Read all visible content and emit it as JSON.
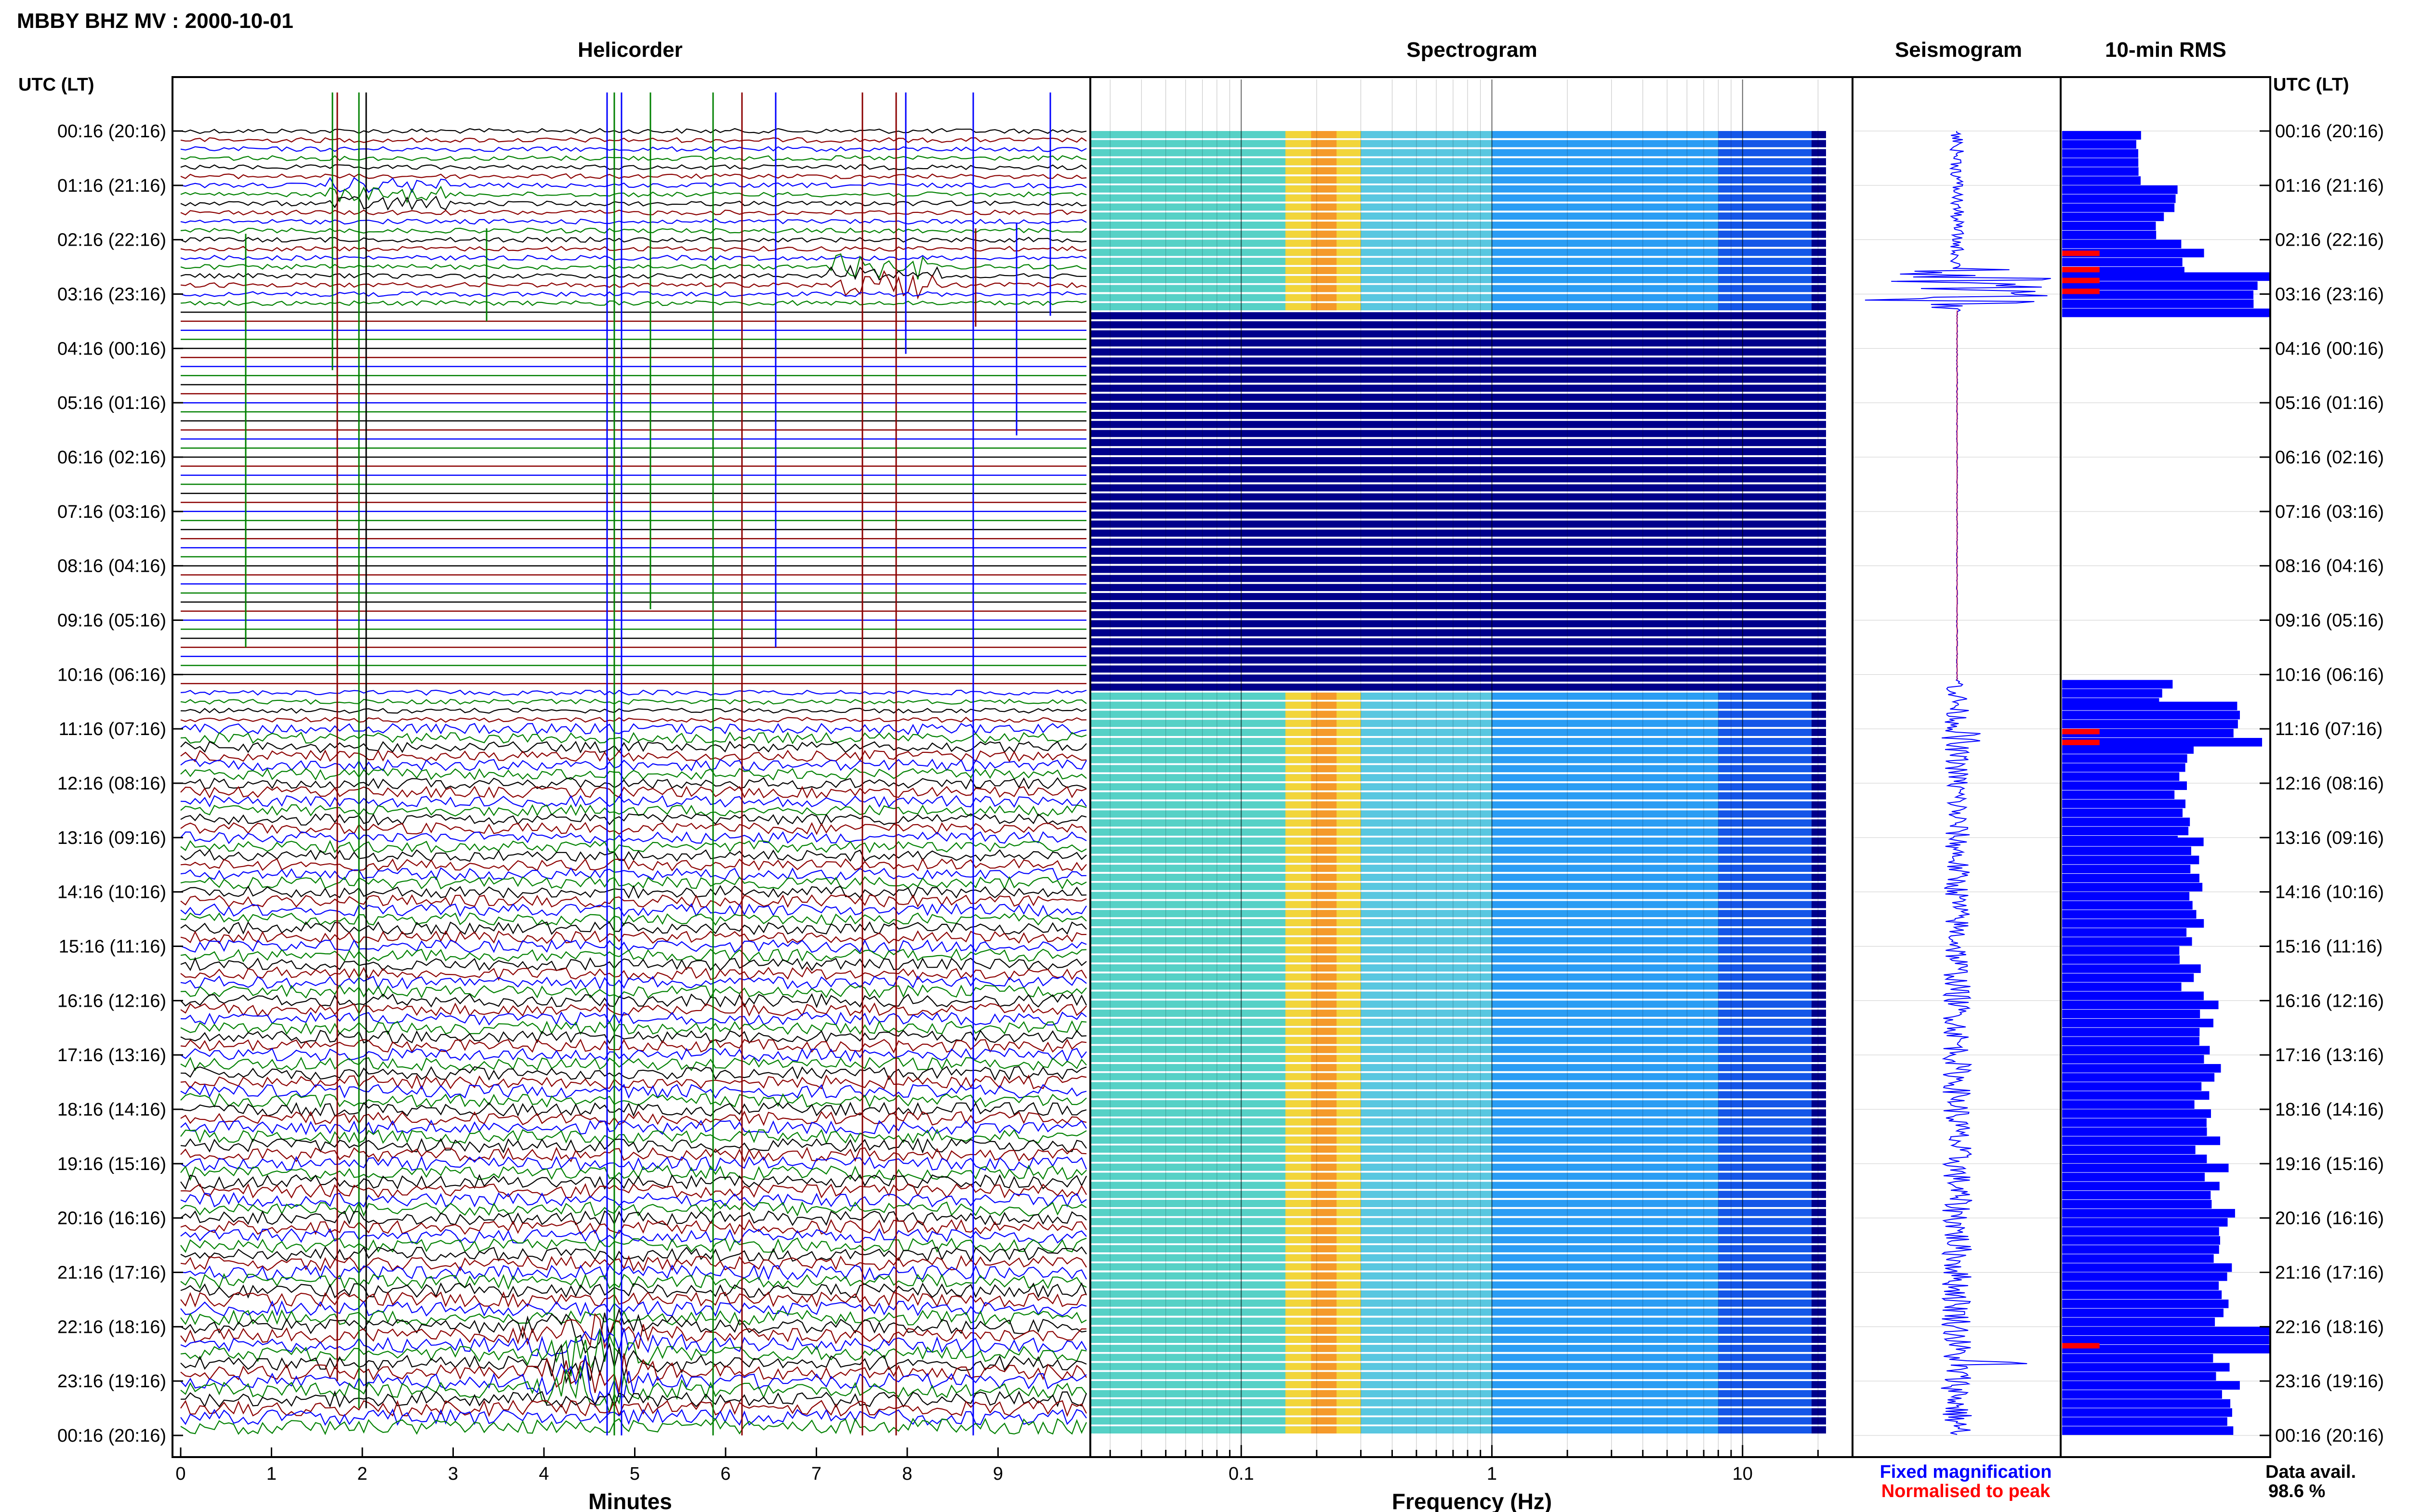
{
  "header": {
    "station_title": "MBBY BHZ MV : 2000-10-01",
    "time_axis_label": "UTC (LT)"
  },
  "panels": {
    "helicorder_title": "Helicorder",
    "spectrogram_title": "Spectrogram",
    "seismogram_title": "Seismogram",
    "rms_title": "10-min RMS"
  },
  "legend": {
    "fixed_magnification": "Fixed magnification",
    "normalised_to_peak": "Normalised to peak",
    "data_avail_label": "Data avail.",
    "data_avail_value": "98.6 %"
  },
  "colors": {
    "blue": "#0000ff",
    "red": "#ff0000",
    "dark_red": "#8b0000",
    "green": "#008000",
    "black": "#000000",
    "spectrogram_low": "#00008b"
  },
  "chart_data": [
    {
      "type": "line",
      "panel": "helicorder",
      "title": "Helicorder",
      "xlabel": "Minutes",
      "xlim": [
        0,
        10
      ],
      "x_ticks": [
        "0",
        "1",
        "2",
        "3",
        "4",
        "5",
        "6",
        "7",
        "8",
        "9"
      ],
      "y_tick_labels": [
        "00:16 (20:16)",
        "01:16 (21:16)",
        "02:16 (22:16)",
        "03:16 (23:16)",
        "04:16 (00:16)",
        "05:16 (01:16)",
        "06:16 (02:16)",
        "07:16 (03:16)",
        "08:16 (04:16)",
        "09:16 (05:16)",
        "10:16 (06:16)",
        "11:16 (07:16)",
        "12:16 (08:16)",
        "13:16 (09:16)",
        "14:16 (10:16)",
        "15:16 (11:16)",
        "16:16 (12:16)",
        "17:16 (13:16)",
        "18:16 (14:16)",
        "19:16 (15:16)",
        "20:16 (16:16)",
        "21:16 (17:16)",
        "22:16 (18:16)",
        "23:16 (19:16)",
        "00:16 (20:16)"
      ],
      "trace_colors_cycle": [
        "black",
        "dark_red",
        "blue",
        "green"
      ],
      "minutes_per_line": 10,
      "lines_total": 144,
      "flat_gap_hours": [
        3.2,
        10.3
      ]
    },
    {
      "type": "heatmap",
      "panel": "spectrogram",
      "title": "Spectrogram",
      "xlabel": "Frequency (Hz)",
      "x_scale": "log",
      "x_ticks": [
        0.1,
        1,
        10
      ],
      "x_tick_labels": [
        "0.1",
        "1",
        "10"
      ],
      "xlim": [
        0.025,
        40
      ],
      "peak_band_hz": [
        0.15,
        0.3
      ],
      "gap_hours": [
        3.2,
        10.3
      ]
    },
    {
      "type": "line",
      "panel": "seismogram",
      "title": "Seismogram",
      "series": [
        {
          "name": "Fixed magnification",
          "color": "blue"
        },
        {
          "name": "Normalised to peak",
          "color": "red"
        }
      ],
      "events_hours": [
        2.9,
        11.2,
        15.1,
        22.7
      ]
    },
    {
      "type": "bar",
      "panel": "rms",
      "title": "10-min RMS",
      "orientation": "horizontal",
      "ylabel": "UTC (LT)",
      "bin_minutes": 10,
      "range_hours": [
        0,
        24
      ],
      "gap_hours": [
        3.3,
        10.1
      ],
      "rms_relative_segments": [
        {
          "from_hour": 0.0,
          "to_hour": 1.0,
          "value": 0.36
        },
        {
          "from_hour": 1.0,
          "to_hour": 1.5,
          "value": 0.52
        },
        {
          "from_hour": 1.5,
          "to_hour": 2.0,
          "value": 0.46
        },
        {
          "from_hour": 2.0,
          "to_hour": 2.6,
          "value": 0.62
        },
        {
          "from_hour": 2.6,
          "to_hour": 3.3,
          "value": 1.0
        },
        {
          "from_hour": 10.1,
          "to_hour": 10.5,
          "value": 0.5
        },
        {
          "from_hour": 10.5,
          "to_hour": 11.3,
          "value": 0.9
        },
        {
          "from_hour": 11.3,
          "to_hour": 13.0,
          "value": 0.58
        },
        {
          "from_hour": 13.0,
          "to_hour": 16.0,
          "value": 0.62
        },
        {
          "from_hour": 16.0,
          "to_hour": 19.0,
          "value": 0.7
        },
        {
          "from_hour": 19.0,
          "to_hour": 22.0,
          "value": 0.76
        },
        {
          "from_hour": 22.0,
          "to_hour": 22.5,
          "value": 1.0
        },
        {
          "from_hour": 22.5,
          "to_hour": 24.0,
          "value": 0.78
        }
      ],
      "peak_marker_hours": [
        2.2,
        2.5,
        2.7,
        2.9,
        11.0,
        11.2,
        22.3
      ]
    }
  ]
}
